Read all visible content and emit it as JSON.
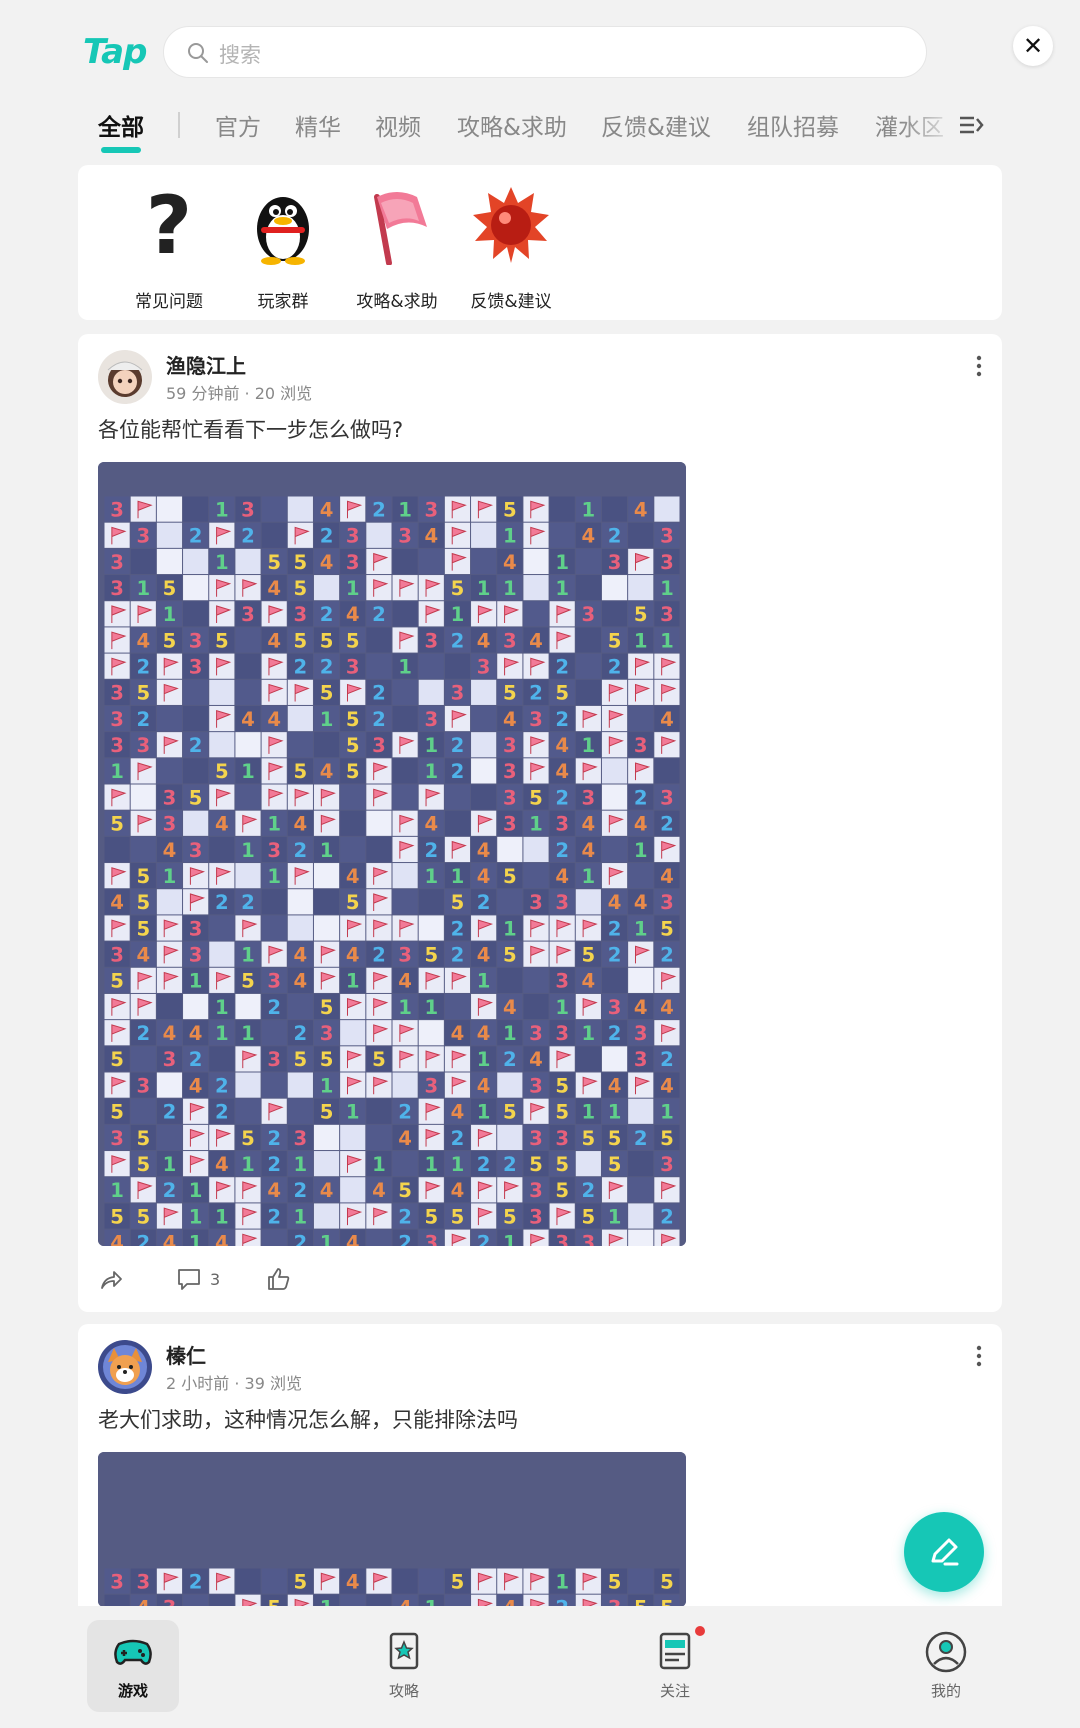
{
  "header": {
    "logo": "Tap",
    "search_placeholder": "搜索"
  },
  "tabs": [
    "全部",
    "官方",
    "精华",
    "视频",
    "攻略&求助",
    "反馈&建议",
    "组队招募",
    "灌水区"
  ],
  "quick_links": [
    {
      "label": "常见问题",
      "icon": "question-mark-icon"
    },
    {
      "label": "玩家群",
      "icon": "qq-penguin-icon"
    },
    {
      "label": "攻略&求助",
      "icon": "pink-flag-icon"
    },
    {
      "label": "反馈&建议",
      "icon": "red-mine-icon"
    }
  ],
  "posts": [
    {
      "author": "渔隐江上",
      "time": "59 分钟前",
      "views": "20 浏览",
      "title": "各位能帮忙看看下一步怎么做吗?",
      "comments": "3"
    },
    {
      "author": "榛仁",
      "time": "2 小时前",
      "views": "39 浏览",
      "title": "老大们求助，这种情况怎么解，只能排除法吗"
    }
  ],
  "bottom_nav": [
    {
      "label": "游戏",
      "icon": "gamepad-icon",
      "active": true
    },
    {
      "label": "攻略",
      "icon": "guide-icon",
      "active": false
    },
    {
      "label": "关注",
      "icon": "follow-icon",
      "active": false
    },
    {
      "label": "我的",
      "icon": "profile-icon",
      "active": false
    }
  ],
  "colors": {
    "accent": "#16c7b6",
    "board": "#555b83",
    "badge": "#e83b3b"
  }
}
